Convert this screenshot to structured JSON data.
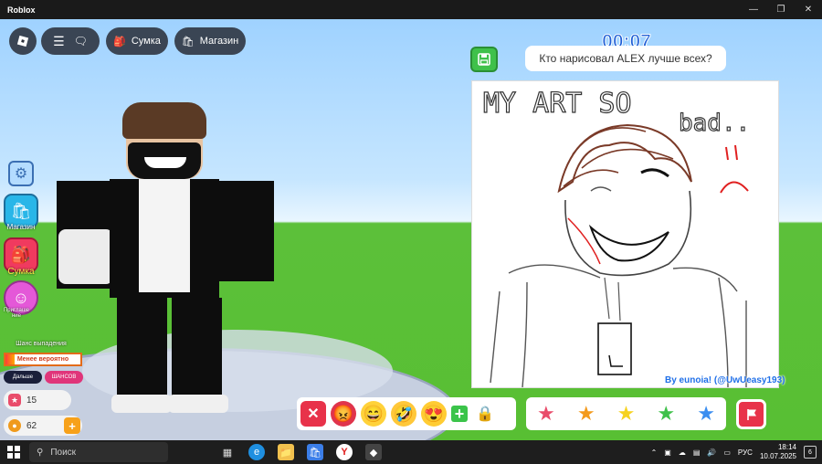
{
  "window": {
    "title": "Roblox",
    "controls": [
      "minimize-icon",
      "restore-icon",
      "close-icon"
    ]
  },
  "hud": {
    "bag_label": "Сумка",
    "shop_label": "Магазин"
  },
  "side_panel": {
    "shop_label": "Магазин",
    "bag_label": "Сумка",
    "invite_label": "Приглаше ние",
    "drop_title": "Шанс выпадения",
    "drop_text": "Менее вероятно",
    "drop_level": 0.12,
    "badge_a": "Дальше",
    "badge_b": "ШАНСОВ",
    "stars_count": "15",
    "coins_count": "62"
  },
  "round": {
    "timer": "00:07",
    "question": "Кто нарисовал ALEX лучше всех?",
    "canvas_text_1": "MY ART SO",
    "canvas_text_2": "bad..",
    "byline": "By eunoia! (@UwUeasy193)"
  },
  "reactions": [
    "angry-face-icon",
    "grinning-face-icon",
    "rofl-face-icon",
    "heart-eyes-icon"
  ],
  "ratings": [
    {
      "name": "star-pink",
      "color": "#e94c6a"
    },
    {
      "name": "star-orange",
      "color": "#f39a1c"
    },
    {
      "name": "star-yellow",
      "color": "#f6d21f"
    },
    {
      "name": "star-green",
      "color": "#3fc14a"
    },
    {
      "name": "star-blue",
      "color": "#3b8ef0"
    }
  ],
  "taskbar": {
    "search_label": "Поиск",
    "language": "РУС",
    "time": "18:14",
    "date": "10.07.2025",
    "notifications": "6"
  }
}
